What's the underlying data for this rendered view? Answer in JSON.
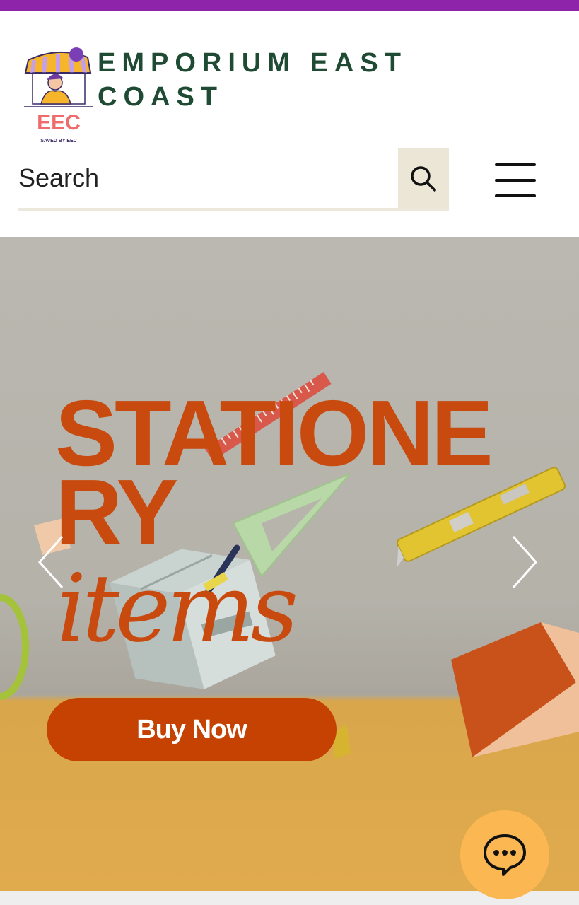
{
  "brand": {
    "name_line1": "EMPORIUM EAST",
    "name_line2": "COAST",
    "logo_text": "EEC",
    "logo_tagline": "SAVED BY EEC",
    "color": "#1f4a33"
  },
  "topbar": {
    "color": "#8e24aa"
  },
  "search": {
    "placeholder": "Search",
    "icon": "search-icon"
  },
  "menu": {
    "icon": "hamburger-menu-icon"
  },
  "hero": {
    "title": "STATIONERY",
    "subtitle": "items",
    "button_label": "Buy Now",
    "accent_color": "#c94a0e",
    "button_color": "#c64203",
    "prev_icon": "chevron-left-icon",
    "next_icon": "chevron-right-icon"
  },
  "chat": {
    "icon": "chat-bubble-icon",
    "color": "#fbb751"
  }
}
